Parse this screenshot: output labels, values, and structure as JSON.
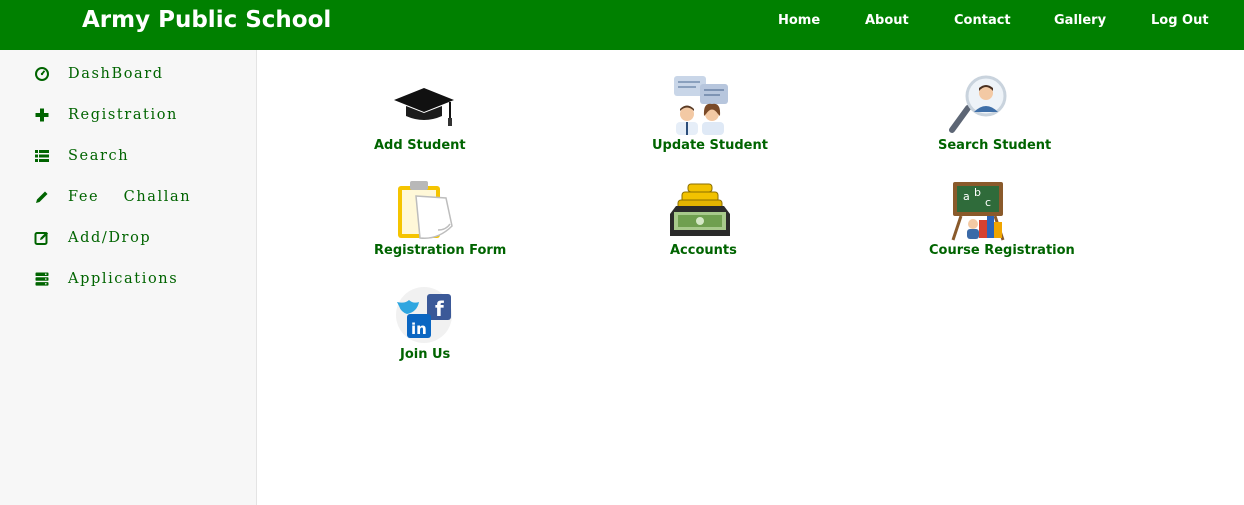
{
  "header": {
    "brand": "Army Public School",
    "nav": [
      {
        "label": "Home"
      },
      {
        "label": "About"
      },
      {
        "label": "Contact"
      },
      {
        "label": "Gallery"
      },
      {
        "label": "Log Out"
      }
    ]
  },
  "sidebar": {
    "items": [
      {
        "label": "DashBoard",
        "icon": "dashboard-icon"
      },
      {
        "label": "Registration",
        "icon": "plus-icon"
      },
      {
        "label": "Search",
        "icon": "list-icon"
      },
      {
        "label": "Fee  Challan",
        "icon": "pencil-icon"
      },
      {
        "label": "Add/Drop",
        "icon": "edit-box-icon"
      },
      {
        "label": "Applications",
        "icon": "server-icon"
      }
    ]
  },
  "tiles": [
    {
      "label": "Add Student",
      "icon": "graduation-cap-icon"
    },
    {
      "label": "Update Student",
      "icon": "people-chat-icon"
    },
    {
      "label": "Search Student",
      "icon": "magnifier-person-icon"
    },
    {
      "label": "Registration Form",
      "icon": "clipboard-icon"
    },
    {
      "label": "Accounts",
      "icon": "money-icon"
    },
    {
      "label": "Course Registration",
      "icon": "chalkboard-icon"
    },
    {
      "label": "Join Us",
      "icon": "social-icon"
    }
  ],
  "colors": {
    "header_bg": "#008000",
    "link_text": "#006400",
    "sidebar_bg": "#f7f7f7"
  }
}
